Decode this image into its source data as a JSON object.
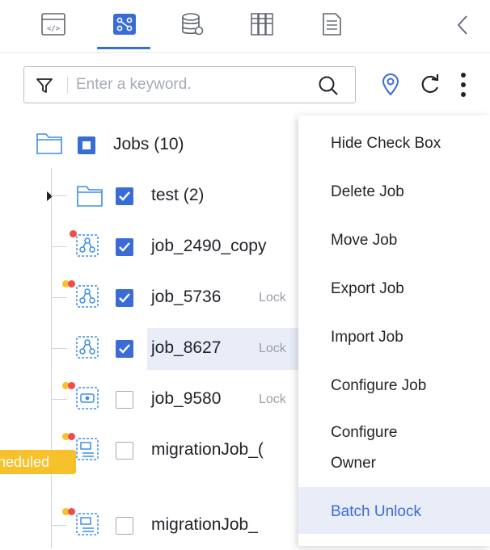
{
  "search": {
    "placeholder": "Enter a keyword."
  },
  "tabs": [
    {
      "icon": "code-file-icon",
      "active": false
    },
    {
      "icon": "job-graph-icon",
      "active": true
    },
    {
      "icon": "database-icon",
      "active": false
    },
    {
      "icon": "resource-grid-icon",
      "active": false
    },
    {
      "icon": "document-icon",
      "active": false
    }
  ],
  "tree": {
    "root": {
      "label": "Jobs",
      "count": "(10)"
    },
    "folder": {
      "label": "test",
      "count": "(2)"
    },
    "jobs": [
      {
        "name": "job_2490_copy",
        "lock": "",
        "checked": true
      },
      {
        "name": "job_5736",
        "lock": "Lock",
        "checked": true
      },
      {
        "name": "job_8627",
        "lock": "Lock",
        "checked": true
      },
      {
        "name": "job_9580",
        "lock": "Lock",
        "checked": false
      },
      {
        "name": "migrationJob_(",
        "lock": "",
        "checked": false
      },
      {
        "name": "migrationJob_",
        "lock": "",
        "checked": false
      }
    ],
    "badge": "heduled"
  },
  "menu": {
    "items": [
      {
        "label": "Hide Check Box"
      },
      {
        "label": "Delete Job"
      },
      {
        "label": "Move Job"
      },
      {
        "label": "Export Job"
      },
      {
        "label": "Import Job"
      },
      {
        "label": "Configure Job"
      },
      {
        "label": "Configure",
        "label2": "Owner"
      },
      {
        "label": "Batch Unlock",
        "active": true
      }
    ]
  },
  "colors": {
    "accent": "#3a6cd8",
    "icon_blue": "#3a8ee6",
    "badge": "#f6c12b",
    "dot_red": "#f04b4b",
    "dot_yellow": "#f6c12b"
  }
}
